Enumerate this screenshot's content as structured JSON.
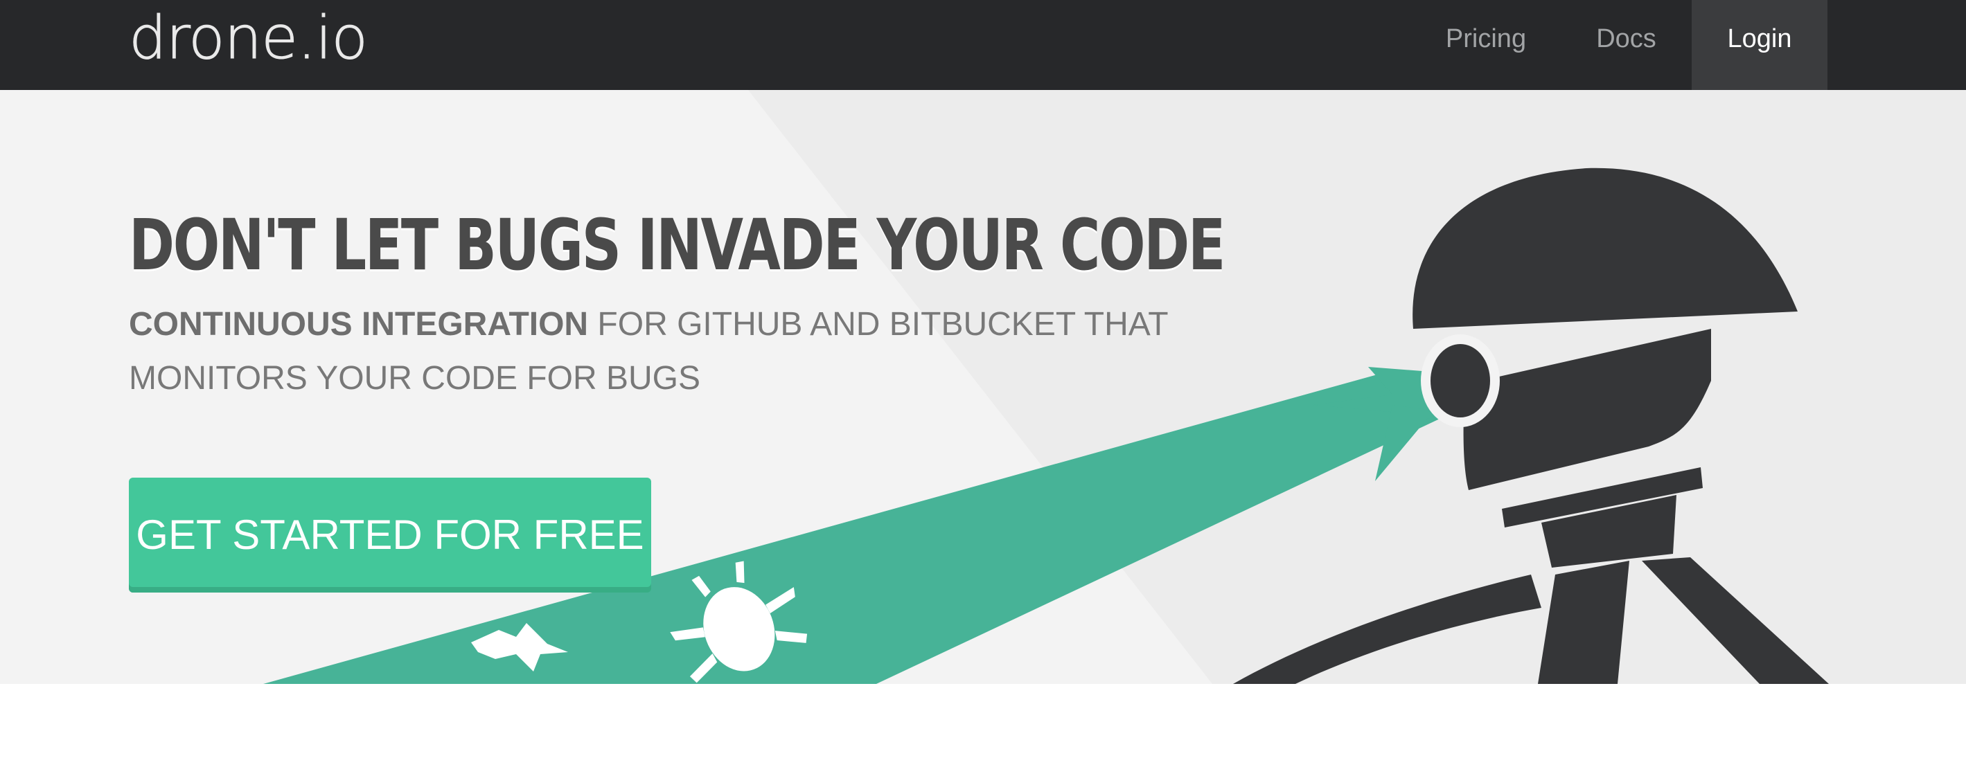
{
  "navbar": {
    "logo": "drone.io",
    "links": [
      {
        "label": "Pricing"
      },
      {
        "label": "Docs"
      },
      {
        "label": "Login",
        "active": true
      }
    ]
  },
  "hero": {
    "title": "DON'T LET BUGS INVADE YOUR CODE",
    "subtitle_strong": "CONTINUOUS INTEGRATION",
    "subtitle_rest": " FOR GITHUB AND BITBUCKET THAT MONITORS YOUR CODE FOR BUGS",
    "cta_label": "GET STARTED FOR FREE",
    "illustration": "drone-robot-scanning-bugs"
  },
  "colors": {
    "navbar_bg": "#27282a",
    "hero_bg": "#f3f3f3",
    "accent_green": "#43c79a",
    "beam_green": "#47b397",
    "robot": "#353638",
    "heading": "#4a4a4a"
  }
}
